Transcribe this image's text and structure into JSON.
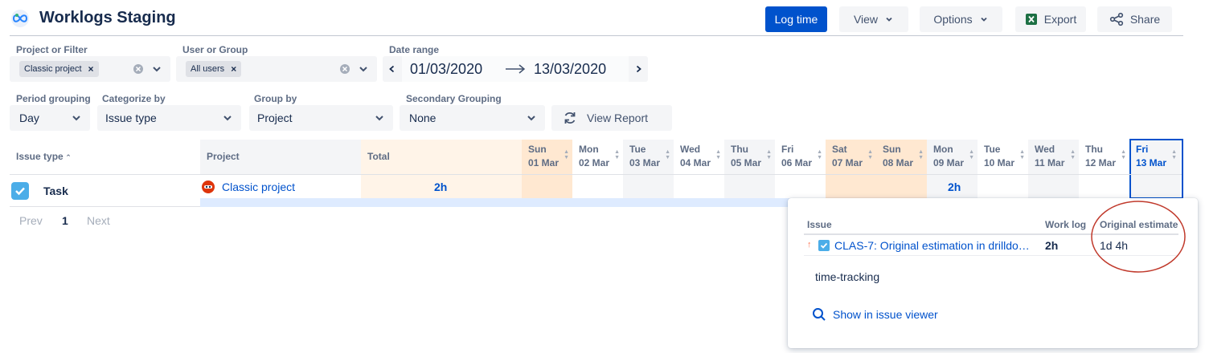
{
  "app": {
    "title": "Worklogs Staging"
  },
  "header": {
    "log_time_label": "Log time",
    "view_label": "View",
    "options_label": "Options",
    "export_label": "Export",
    "share_label": "Share"
  },
  "filters": {
    "project_label": "Project or Filter",
    "project_tag": "Classic project",
    "user_label": "User or Group",
    "user_tag": "All users",
    "date_label": "Date range",
    "date_from": "01/03/2020",
    "date_to": "13/03/2020",
    "period_label": "Period grouping",
    "period_value": "Day",
    "categorize_label": "Categorize by",
    "categorize_value": "Issue type",
    "group_label": "Group by",
    "group_value": "Project",
    "secondary_label": "Secondary Grouping",
    "secondary_value": "None",
    "view_report_label": "View Report"
  },
  "table": {
    "issue_type_header": "Issue type",
    "project_header": "Project",
    "total_header": "Total",
    "days": [
      {
        "dow": "Sun",
        "date": "01 Mar",
        "weekend": true
      },
      {
        "dow": "Mon",
        "date": "02 Mar",
        "weekend": false
      },
      {
        "dow": "Tue",
        "date": "03 Mar",
        "weekend": false
      },
      {
        "dow": "Wed",
        "date": "04 Mar",
        "weekend": false
      },
      {
        "dow": "Thu",
        "date": "05 Mar",
        "weekend": false
      },
      {
        "dow": "Fri",
        "date": "06 Mar",
        "weekend": false
      },
      {
        "dow": "Sat",
        "date": "07 Mar",
        "weekend": true
      },
      {
        "dow": "Sun",
        "date": "08 Mar",
        "weekend": true
      },
      {
        "dow": "Mon",
        "date": "09 Mar",
        "weekend": false
      },
      {
        "dow": "Tue",
        "date": "10 Mar",
        "weekend": false
      },
      {
        "dow": "Wed",
        "date": "11 Mar",
        "weekend": false
      },
      {
        "dow": "Thu",
        "date": "12 Mar",
        "weekend": false
      },
      {
        "dow": "Fri",
        "date": "13 Mar",
        "weekend": false,
        "selected": true
      }
    ],
    "row": {
      "issue_type": "Task",
      "project": "Classic project",
      "total": "2h",
      "day_values": [
        "",
        "",
        "",
        "",
        "",
        "",
        "",
        "",
        "2h",
        "",
        "",
        "",
        ""
      ]
    }
  },
  "pagination": {
    "prev": "Prev",
    "page": "1",
    "next": "Next"
  },
  "popup": {
    "issue_header": "Issue",
    "worklog_header": "Work log",
    "estimate_header": "Original estimate",
    "issue_link": "CLAS-7: Original estimation in drilldo…",
    "worklog_value": "2h",
    "estimate_value": "1d 4h",
    "label_text": "time-tracking",
    "show_in_viewer": "Show in issue viewer"
  },
  "colors": {
    "primary": "#0052cc",
    "weekend": "#ffebd6",
    "weekend_dark": "#ffe0c2",
    "highlight_circle": "#c0392b"
  }
}
